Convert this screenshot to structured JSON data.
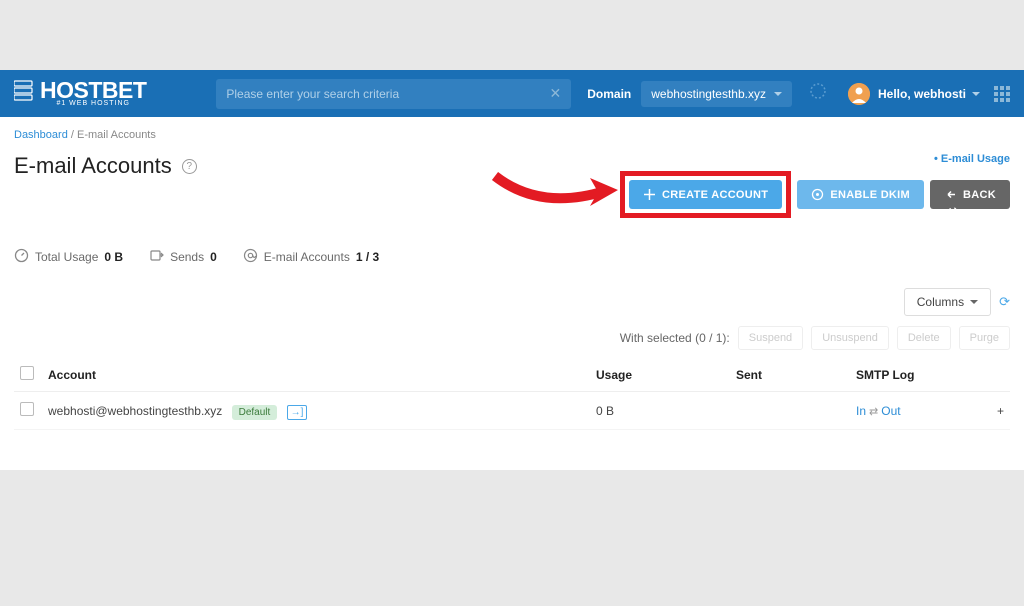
{
  "header": {
    "brand": "HOSTBET",
    "tagline": "#1 WEB HOSTING",
    "search_placeholder": "Please enter your search criteria",
    "domain_label": "Domain",
    "domain_value": "webhostingtesthb.xyz",
    "greeting": "Hello, webhosti"
  },
  "breadcrumb": {
    "root": "Dashboard",
    "current": "E-mail Accounts"
  },
  "page": {
    "title": "E-mail Accounts",
    "email_usage_link": "• E-mail Usage"
  },
  "buttons": {
    "create": "CREATE ACCOUNT",
    "dkim": "ENABLE DKIM",
    "back": "BACK"
  },
  "stats": {
    "total_usage_label": "Total Usage",
    "total_usage_value": "0 B",
    "sends_label": "Sends",
    "sends_value": "0",
    "accounts_label": "E-mail Accounts",
    "accounts_value": "1 / 3"
  },
  "table_controls": {
    "columns": "Columns"
  },
  "bulk": {
    "label": "With selected (0 / 1):",
    "suspend": "Suspend",
    "unsuspend": "Unsuspend",
    "delete": "Delete",
    "purge": "Purge"
  },
  "columns": {
    "account": "Account",
    "usage": "Usage",
    "sent": "Sent",
    "smtp": "SMTP Log"
  },
  "rows": [
    {
      "account": "webhosti@webhostingtesthb.xyz",
      "default_badge": "Default",
      "usage": "0 B",
      "sent": "",
      "smtp_in": "In",
      "smtp_out": "Out"
    }
  ]
}
